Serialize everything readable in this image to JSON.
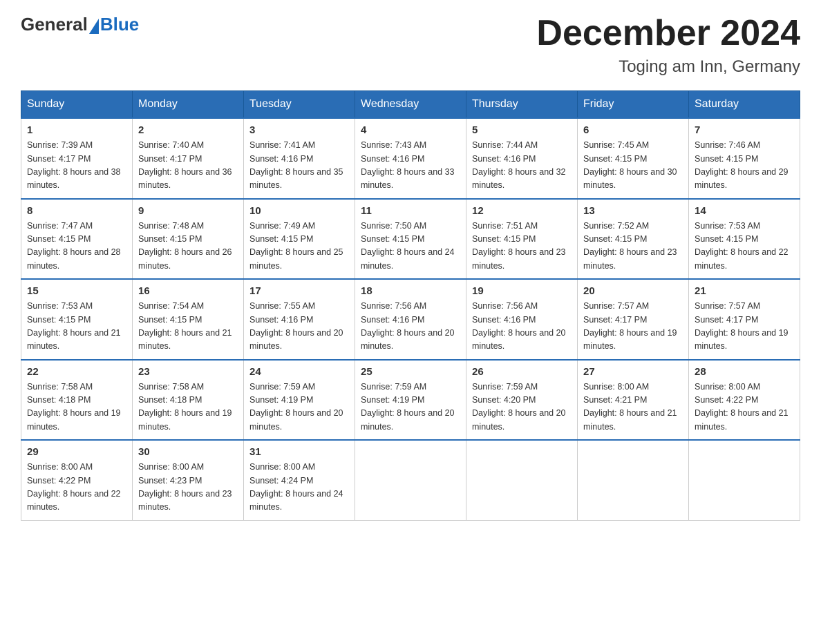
{
  "header": {
    "logo_general": "General",
    "logo_blue": "Blue",
    "month_title": "December 2024",
    "location": "Toging am Inn, Germany"
  },
  "weekdays": [
    "Sunday",
    "Monday",
    "Tuesday",
    "Wednesday",
    "Thursday",
    "Friday",
    "Saturday"
  ],
  "weeks": [
    [
      {
        "day": "1",
        "sunrise": "7:39 AM",
        "sunset": "4:17 PM",
        "daylight": "8 hours and 38 minutes."
      },
      {
        "day": "2",
        "sunrise": "7:40 AM",
        "sunset": "4:17 PM",
        "daylight": "8 hours and 36 minutes."
      },
      {
        "day": "3",
        "sunrise": "7:41 AM",
        "sunset": "4:16 PM",
        "daylight": "8 hours and 35 minutes."
      },
      {
        "day": "4",
        "sunrise": "7:43 AM",
        "sunset": "4:16 PM",
        "daylight": "8 hours and 33 minutes."
      },
      {
        "day": "5",
        "sunrise": "7:44 AM",
        "sunset": "4:16 PM",
        "daylight": "8 hours and 32 minutes."
      },
      {
        "day": "6",
        "sunrise": "7:45 AM",
        "sunset": "4:15 PM",
        "daylight": "8 hours and 30 minutes."
      },
      {
        "day": "7",
        "sunrise": "7:46 AM",
        "sunset": "4:15 PM",
        "daylight": "8 hours and 29 minutes."
      }
    ],
    [
      {
        "day": "8",
        "sunrise": "7:47 AM",
        "sunset": "4:15 PM",
        "daylight": "8 hours and 28 minutes."
      },
      {
        "day": "9",
        "sunrise": "7:48 AM",
        "sunset": "4:15 PM",
        "daylight": "8 hours and 26 minutes."
      },
      {
        "day": "10",
        "sunrise": "7:49 AM",
        "sunset": "4:15 PM",
        "daylight": "8 hours and 25 minutes."
      },
      {
        "day": "11",
        "sunrise": "7:50 AM",
        "sunset": "4:15 PM",
        "daylight": "8 hours and 24 minutes."
      },
      {
        "day": "12",
        "sunrise": "7:51 AM",
        "sunset": "4:15 PM",
        "daylight": "8 hours and 23 minutes."
      },
      {
        "day": "13",
        "sunrise": "7:52 AM",
        "sunset": "4:15 PM",
        "daylight": "8 hours and 23 minutes."
      },
      {
        "day": "14",
        "sunrise": "7:53 AM",
        "sunset": "4:15 PM",
        "daylight": "8 hours and 22 minutes."
      }
    ],
    [
      {
        "day": "15",
        "sunrise": "7:53 AM",
        "sunset": "4:15 PM",
        "daylight": "8 hours and 21 minutes."
      },
      {
        "day": "16",
        "sunrise": "7:54 AM",
        "sunset": "4:15 PM",
        "daylight": "8 hours and 21 minutes."
      },
      {
        "day": "17",
        "sunrise": "7:55 AM",
        "sunset": "4:16 PM",
        "daylight": "8 hours and 20 minutes."
      },
      {
        "day": "18",
        "sunrise": "7:56 AM",
        "sunset": "4:16 PM",
        "daylight": "8 hours and 20 minutes."
      },
      {
        "day": "19",
        "sunrise": "7:56 AM",
        "sunset": "4:16 PM",
        "daylight": "8 hours and 20 minutes."
      },
      {
        "day": "20",
        "sunrise": "7:57 AM",
        "sunset": "4:17 PM",
        "daylight": "8 hours and 19 minutes."
      },
      {
        "day": "21",
        "sunrise": "7:57 AM",
        "sunset": "4:17 PM",
        "daylight": "8 hours and 19 minutes."
      }
    ],
    [
      {
        "day": "22",
        "sunrise": "7:58 AM",
        "sunset": "4:18 PM",
        "daylight": "8 hours and 19 minutes."
      },
      {
        "day": "23",
        "sunrise": "7:58 AM",
        "sunset": "4:18 PM",
        "daylight": "8 hours and 19 minutes."
      },
      {
        "day": "24",
        "sunrise": "7:59 AM",
        "sunset": "4:19 PM",
        "daylight": "8 hours and 20 minutes."
      },
      {
        "day": "25",
        "sunrise": "7:59 AM",
        "sunset": "4:19 PM",
        "daylight": "8 hours and 20 minutes."
      },
      {
        "day": "26",
        "sunrise": "7:59 AM",
        "sunset": "4:20 PM",
        "daylight": "8 hours and 20 minutes."
      },
      {
        "day": "27",
        "sunrise": "8:00 AM",
        "sunset": "4:21 PM",
        "daylight": "8 hours and 21 minutes."
      },
      {
        "day": "28",
        "sunrise": "8:00 AM",
        "sunset": "4:22 PM",
        "daylight": "8 hours and 21 minutes."
      }
    ],
    [
      {
        "day": "29",
        "sunrise": "8:00 AM",
        "sunset": "4:22 PM",
        "daylight": "8 hours and 22 minutes."
      },
      {
        "day": "30",
        "sunrise": "8:00 AM",
        "sunset": "4:23 PM",
        "daylight": "8 hours and 23 minutes."
      },
      {
        "day": "31",
        "sunrise": "8:00 AM",
        "sunset": "4:24 PM",
        "daylight": "8 hours and 24 minutes."
      },
      null,
      null,
      null,
      null
    ]
  ]
}
